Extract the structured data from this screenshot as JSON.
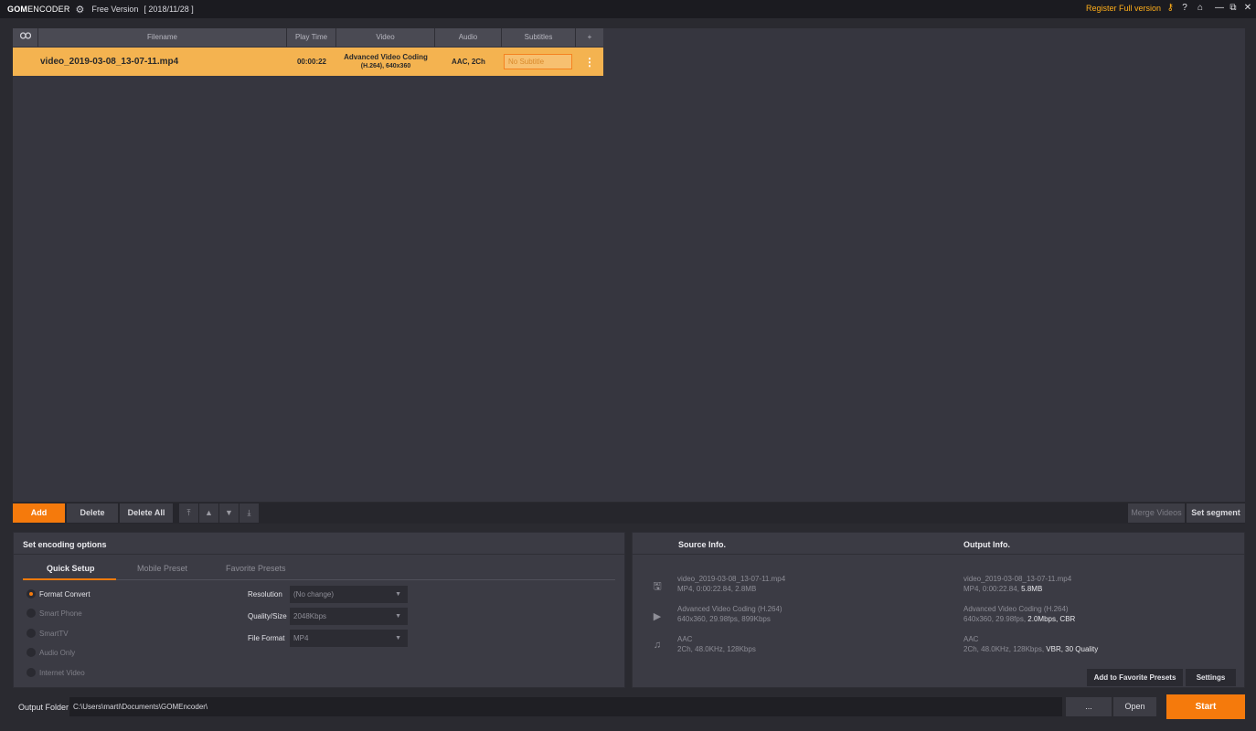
{
  "titlebar": {
    "logo_bold": "GOM",
    "logo_rest": "ENCODER",
    "version": "Free Version",
    "date": "[ 2018/11/28 ]",
    "register": "Register Full version",
    "icons": [
      "settings-icon",
      "key-icon",
      "help-icon",
      "home-icon",
      "minimize-icon",
      "restore-icon",
      "close-icon"
    ],
    "help_glyph": "?",
    "home_glyph": "⌂",
    "min_glyph": "—",
    "restore_glyph": "⧉",
    "close_glyph": "✕"
  },
  "file_list": {
    "columns": [
      "",
      "Filename",
      "Play Time",
      "Video",
      "Audio",
      "Subtitles",
      "+"
    ],
    "rows": [
      {
        "filename": "video_2019-03-08_13-07-11.mp4",
        "play_time": "00:00:22",
        "video_line1": "Advanced Video Coding",
        "video_line2": "(H.264), 640x360",
        "audio": "AAC, 2Ch",
        "subtitle": "No Subtitle"
      }
    ]
  },
  "actions": {
    "add": "Add",
    "delete": "Delete",
    "delete_all": "Delete All",
    "merge": "Merge Videos",
    "set_segment": "Set segment"
  },
  "encoding": {
    "title": "Set encoding options",
    "tabs": [
      "Quick Setup",
      "Mobile Preset",
      "Favorite Presets"
    ],
    "active_tab": "Quick Setup",
    "options": [
      "Format Convert",
      "Smart Phone",
      "SmartTV",
      "Audio Only",
      "Internet Video"
    ],
    "selected_option": "Format Convert",
    "fields": [
      {
        "label": "Resolution",
        "value": "(No change)"
      },
      {
        "label": "Quality/Size",
        "value": "2048Kbps"
      },
      {
        "label": "File Format",
        "value": "MP4"
      }
    ]
  },
  "info": {
    "source_title": "Source Info.",
    "output_title": "Output Info.",
    "source": {
      "file": [
        "video_2019-03-08_13-07-11.mp4",
        "MP4, 0:00:22.84, 2.8MB"
      ],
      "video": [
        "Advanced Video Coding (H.264)",
        "640x360, 29.98fps, 899Kbps"
      ],
      "audio": [
        "AAC",
        "2Ch, 48.0KHz, 128Kbps"
      ]
    },
    "output": {
      "file_name": "video_2019-03-08_13-07-11.mp4",
      "file_prefix": "MP4, 0:00:22.84, ",
      "file_highlight": "5.8MB",
      "video_name": "Advanced Video Coding (H.264)",
      "video_prefix": "640x360, 29.98fps, ",
      "video_highlight": "2.0Mbps, CBR",
      "audio_name": "AAC",
      "audio_prefix": "2Ch, 48.0KHz, 128Kbps, ",
      "audio_highlight": "VBR, 30 Quality"
    },
    "add_favorite": "Add to Favorite Presets",
    "settings": "Settings"
  },
  "output_folder": {
    "label": "Output Folder",
    "path": "C:\\Users\\marti\\Documents\\GOMEncoder\\",
    "browse": "...",
    "open": "Open",
    "start": "Start"
  },
  "colors": {
    "accent": "#f57a0c",
    "row_highlight": "#f4b350",
    "register_text": "#ffae1a"
  }
}
